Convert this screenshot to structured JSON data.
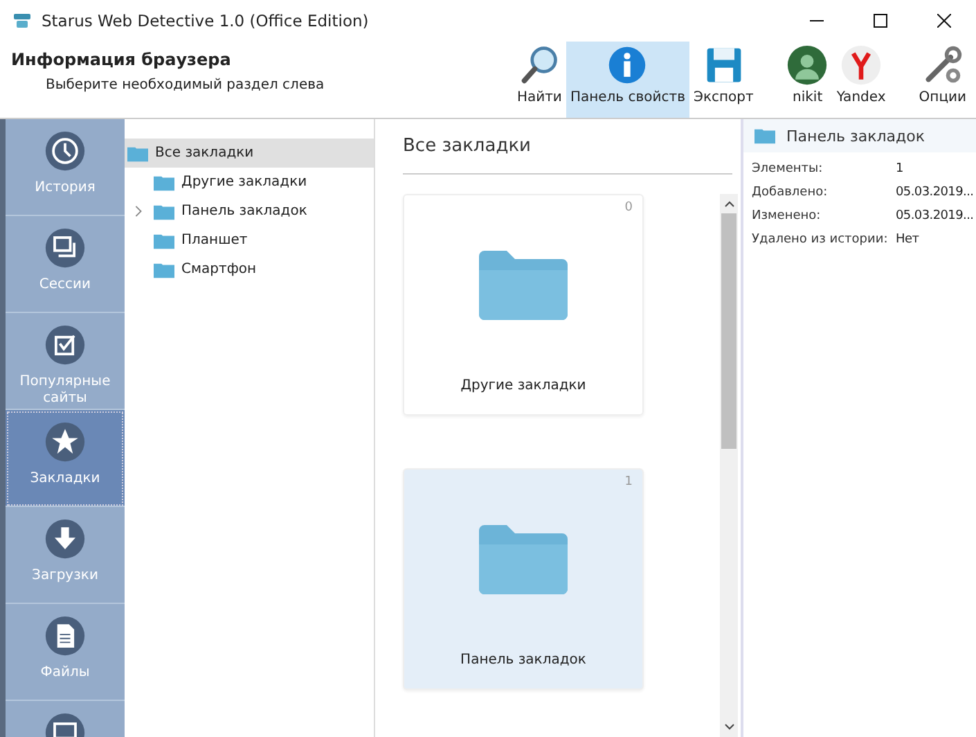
{
  "window": {
    "title": "Starus Web Detective 1.0 (Office Edition)"
  },
  "header": {
    "title": "Информация браузера",
    "subtitle": "Выберите необходимый раздел слева"
  },
  "toolbar": [
    {
      "kind": "search",
      "label": "Найти",
      "selected": false
    },
    {
      "kind": "info",
      "label": "Панель свойств",
      "selected": true
    },
    {
      "kind": "save",
      "label": "Экспорт",
      "selected": false
    },
    {
      "kind": "avatar",
      "label": "nikit",
      "selected": false
    },
    {
      "kind": "yandex",
      "label": "Yandex",
      "selected": false
    },
    {
      "kind": "tools",
      "label": "Опции",
      "selected": false
    }
  ],
  "sidebar": {
    "items": [
      {
        "kind": "clock",
        "label": "История",
        "selected": false
      },
      {
        "kind": "windows",
        "label": "Сессии",
        "selected": false
      },
      {
        "kind": "check",
        "label": "Популярные сайты",
        "selected": false
      },
      {
        "kind": "star",
        "label": "Закладки",
        "selected": true
      },
      {
        "kind": "download",
        "label": "Загрузки",
        "selected": false
      },
      {
        "kind": "file",
        "label": "Файлы",
        "selected": false
      },
      {
        "kind": "screen",
        "selected": false
      }
    ]
  },
  "tree": [
    {
      "label": "Все закладки",
      "selected": true,
      "children": [
        {
          "label": "Другие закладки",
          "selected": false,
          "expandable": false
        },
        {
          "label": "Панель закладок",
          "selected": false,
          "expandable": true
        },
        {
          "label": "Планшет",
          "selected": false,
          "expandable": false
        },
        {
          "label": "Смартфон",
          "selected": false,
          "expandable": false
        }
      ]
    }
  ],
  "content": {
    "title": "Все закладки",
    "cards": [
      {
        "label": "Другие закладки",
        "count": "0",
        "selected": false
      },
      {
        "label": "Панель закладок",
        "count": "1",
        "selected": true
      }
    ]
  },
  "properties": {
    "title": "Панель закладок",
    "rows": [
      {
        "label": "Элементы:",
        "value": "1"
      },
      {
        "label": "Добавлено:",
        "value": "05.03.2019..."
      },
      {
        "label": "Изменено:",
        "value": "05.03.2019..."
      },
      {
        "label": "Удалено из истории:",
        "value": "Нет"
      }
    ]
  }
}
